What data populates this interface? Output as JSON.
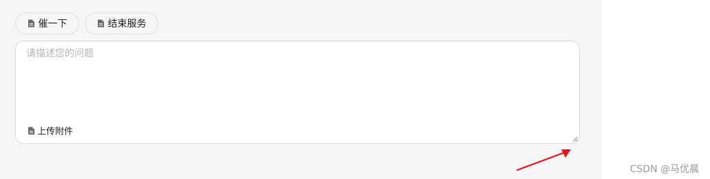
{
  "buttons": {
    "urge_label": "催一下",
    "end_service_label": "结束服务"
  },
  "editor": {
    "placeholder": "请描述您的问题",
    "value": "",
    "upload_label": "上传附件"
  },
  "watermark": "CSDN @马优晨",
  "colors": {
    "panel_bg": "#f6f6f6",
    "annotation_arrow": "#e8141c",
    "placeholder": "#b4b4b4"
  },
  "icons": {
    "button_icon": "document-icon",
    "upload_icon": "document-icon",
    "resize": "resize-handle-icon",
    "annotation": "arrow-icon"
  }
}
